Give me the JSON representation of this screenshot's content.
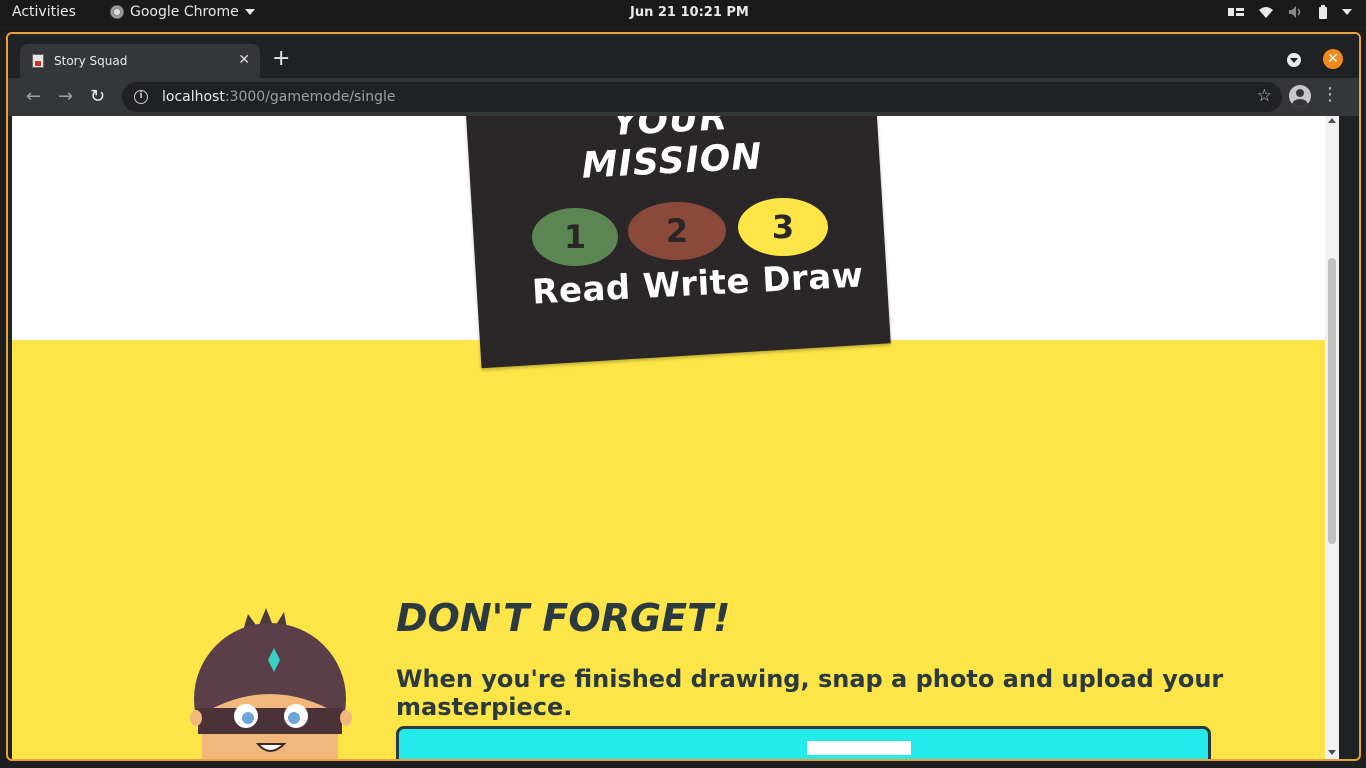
{
  "system_bar": {
    "activities": "Activities",
    "app_name": "Google Chrome",
    "clock": "Jun 21  10:21 PM"
  },
  "browser": {
    "tab_title": "Story Squad",
    "url_host": "localhost",
    "url_path": ":3000/gamemode/single"
  },
  "page": {
    "mission_heading": "YOUR MISSION",
    "steps": [
      {
        "number": "1",
        "color": "#5b8653"
      },
      {
        "number": "2",
        "color": "#8a4a3a"
      },
      {
        "number": "3",
        "color": "#fde547"
      }
    ],
    "steps_caption": "Read Write Draw",
    "reminder_heading": "DON'T FORGET!",
    "reminder_text": "When you're finished drawing, snap a photo and upload your masterpiece."
  },
  "colors": {
    "accent_yellow": "#fde547",
    "dark_card": "#2b2627",
    "upload_cyan": "#22ebe9",
    "text_dark": "#2b3940"
  }
}
